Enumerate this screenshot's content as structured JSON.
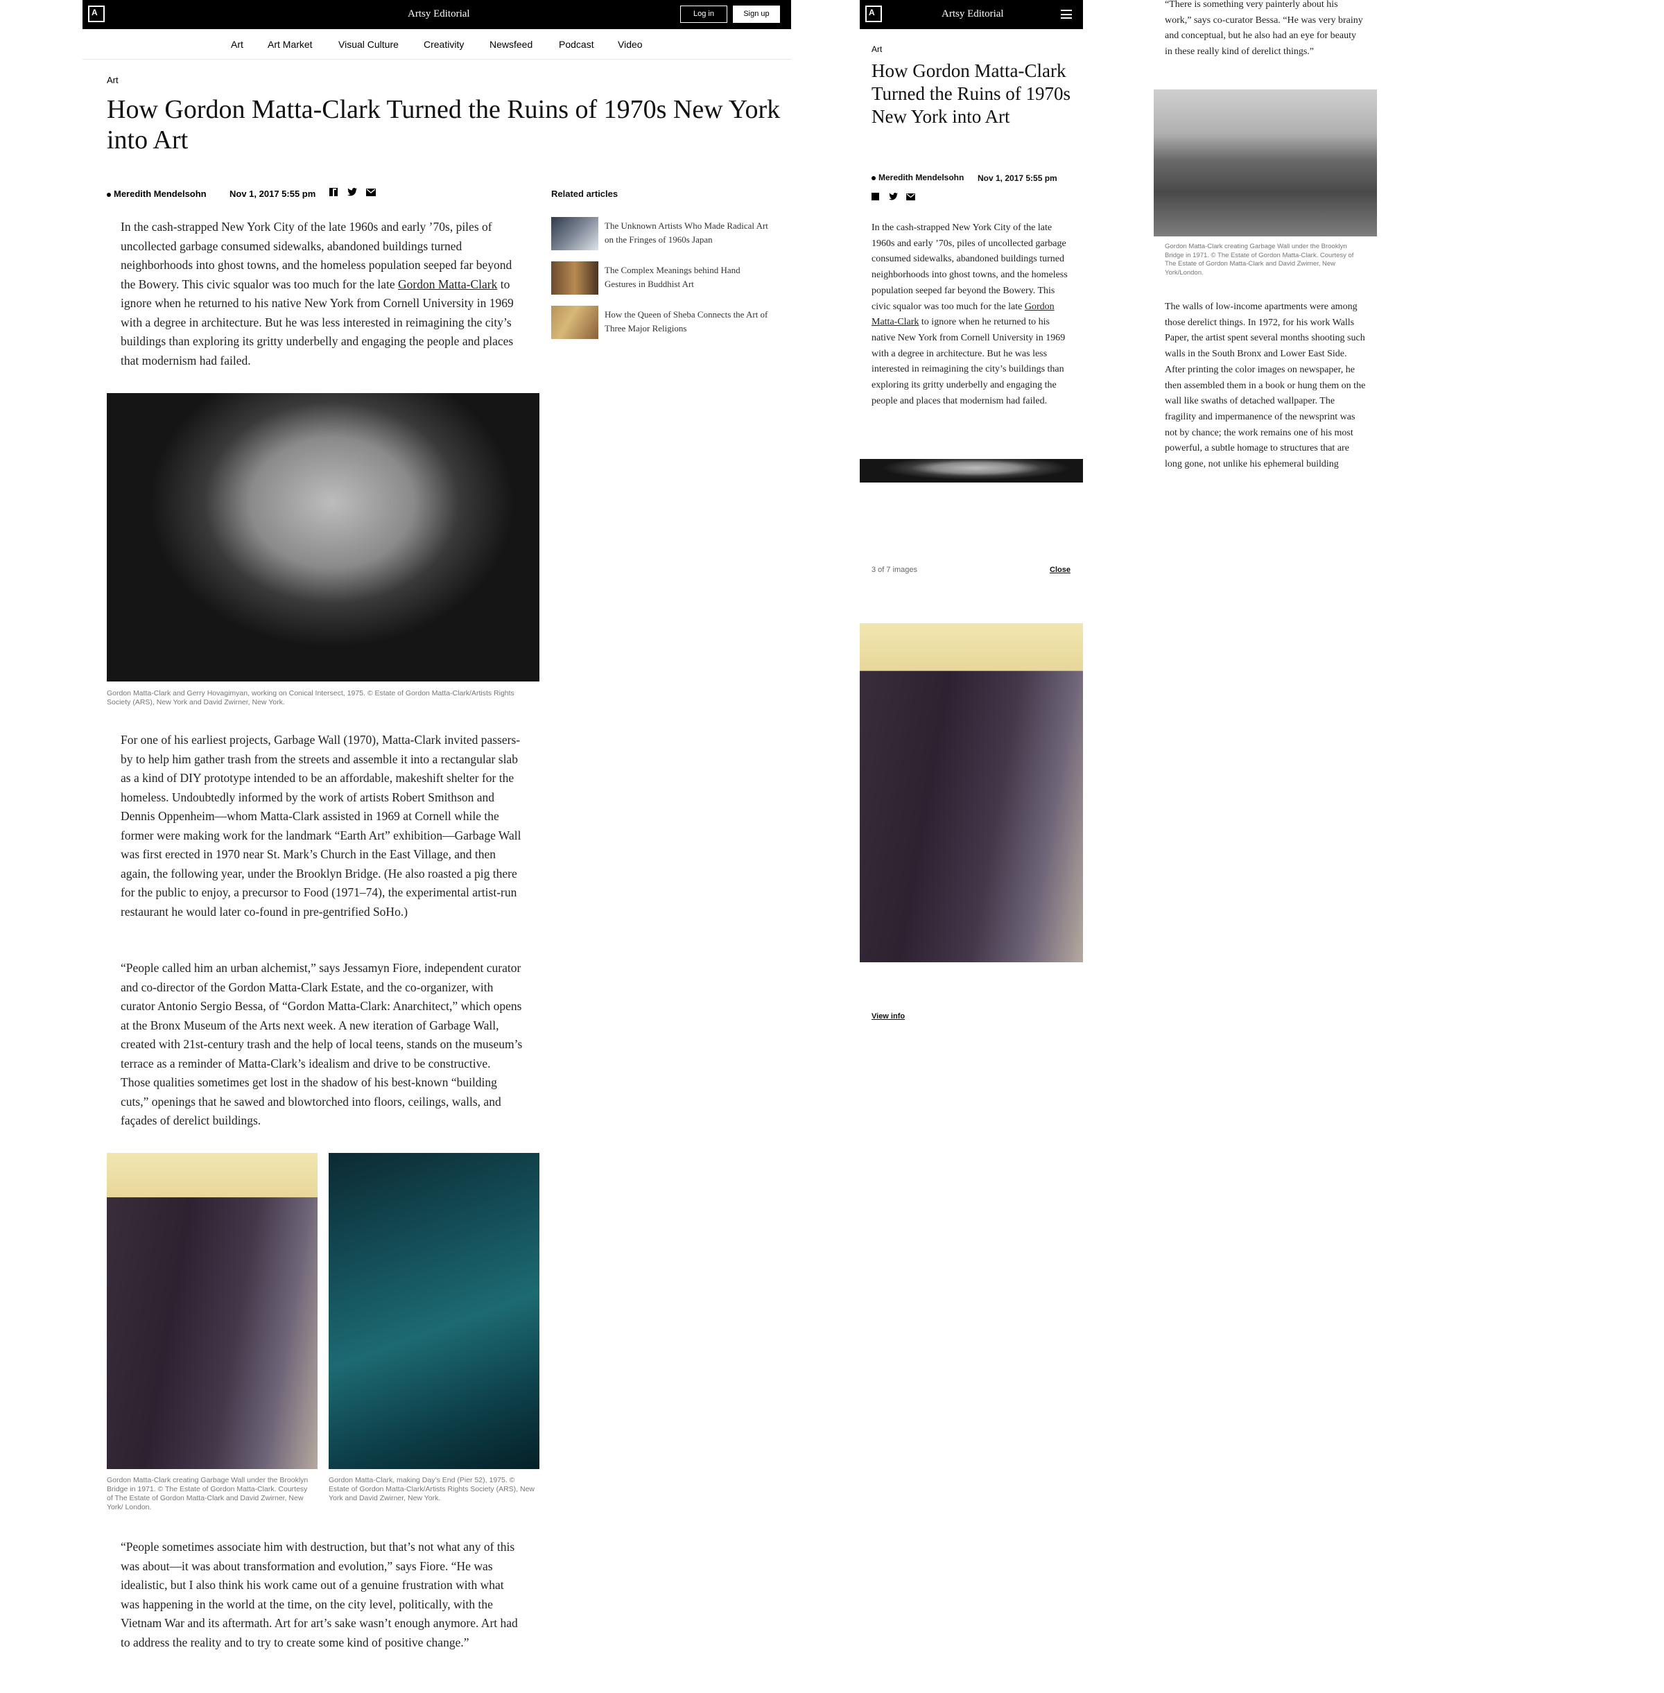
{
  "brand": "Artsy Editorial",
  "logo_text": "A",
  "auth": {
    "login": "Log in",
    "signup": "Sign up"
  },
  "nav": [
    "Art",
    "Art Market",
    "Visual Culture",
    "Creativity",
    "Newsfeed",
    "Podcast",
    "Video"
  ],
  "article": {
    "kicker": "Art",
    "title": "How Gordon Matta-Clark Turned the Ruins of 1970s New York into Art",
    "mobile_title": "How Gordon Matta-Clark Turned the Ruins of 1970s New York into Art",
    "author": "Meredith Mendelsohn",
    "date": "Nov 1, 2017 5:55 pm",
    "share_icons": [
      "facebook-icon",
      "twitter-icon",
      "email-icon"
    ],
    "p1_a": "In the cash-strapped New York City of the late 1960s and early ’70s, piles of uncollected garbage consumed sidewalks, abandoned buildings turned neighborhoods into ghost towns, and the homeless population seeped far beyond the Bowery. This civic squalor was too much for the late ",
    "p1_link": "Gordon Matta-Clark",
    "p1_b": " to ignore when he returned to his native New York from Cornell University in 1969 with a degree in architecture. But he was less interested in reimagining the city’s buildings than exploring its gritty underbelly and engaging the people and places that modernism had failed.",
    "caption1": "Gordon Matta-Clark and Gerry Hovagimyan, working on Conical Intersect, 1975. © Estate of Gordon Matta-Clark/Artists Rights Society (ARS), New York and David Zwirner, New York.",
    "p2": "For one of his earliest projects, Garbage Wall (1970), Matta-Clark invited passers-by to help him gather trash from the streets and assemble it into a rectangular slab as a kind of DIY prototype intended to be an affordable, makeshift shelter for the homeless. Undoubtedly informed by the work of artists Robert Smithson and Dennis Oppenheim—whom Matta-Clark assisted in 1969 at Cornell while the former were making work for the landmark “Earth Art” exhibition—Garbage Wall was first erected in 1970 near St. Mark’s Church in the East Village, and then again, the following year, under the Brooklyn Bridge. (He also roasted a pig there for the public to enjoy, a precursor to Food (1971–74), the experimental artist-run restaurant he would later co-found in pre-gentrified SoHo.)",
    "p3": "“People called him an urban alchemist,” says Jessamyn Fiore, independent curator and co-director of the Gordon Matta-Clark Estate, and the co-organizer, with curator Antonio Sergio Bessa, of “Gordon Matta-Clark: Anarchitect,” which opens at the Bronx Museum of the Arts next week. A new iteration of Garbage Wall, created with 21st-century trash and the help of local teens, stands on the museum’s terrace as a reminder of Matta-Clark’s idealism and drive to be constructive. Those qualities sometimes get lost in the shadow of his best-known “building cuts,” openings that he sawed and blowtorched into floors, ceilings, walls, and façades of derelict buildings.",
    "caption2": "Gordon Matta-Clark creating Garbage Wall  under the Brooklyn Bridge in 1971. © The Estate of Gordon Matta-Clark. Courtesy of The Estate of Gordon Matta-Clark and David Zwirner, New York/ London.",
    "caption3": "Gordon Matta-Clark, making Day’s End (Pier 52), 1975. © Estate of Gordon Matta-Clark/Artists Rights Society (ARS), New York and David Zwirner, New York.",
    "p4": "“People sometimes associate him with destruction, but that’s not what any of this was about—it was about transformation and evolution,” says Fiore. “He was idealistic, but I also think his work came out of a genuine frustration with what was happening in the world at the time, on the city level, politically, with the Vietnam War and its aftermath. Art for art’s sake wasn’t enough anymore. Art had to address the reality and to try to create some kind of positive change.”"
  },
  "related": {
    "title": "Related articles",
    "items": [
      "The Unknown Artists Who Made Radical Art on the Fringes of 1960s Japan",
      "The Complex Meanings behind Hand Gestures in Buddhist Art",
      "How the Queen of Sheba Connects the Art of Three Major Religions"
    ]
  },
  "mobile": {
    "gallery_count": "3 of 7 images",
    "close": "Close",
    "view_info": "View info",
    "quote_top": "“There is something very painterly about his work,” says co-curator Bessa. “He was very brainy and conceptual, but he also had an eye for beauty in these really kind of derelict things.”",
    "caption_bw": "Gordon Matta-Clark creating Garbage Wall  under the Brooklyn Bridge in 1971. © The Estate of Gordon Matta-Clark. Courtesy of The Estate of Gordon Matta-Clark and David Zwirner, New York/London.",
    "p_walls": "The walls of low-income apartments were among those derelict things. In 1972, for his work Walls Paper, the artist spent several months shooting such walls in the South Bronx and Lower East Side. After printing the color images on newspaper, he then assembled them in a book or hung them on the wall like swaths of detached wallpaper. The fragility and impermanence of the newsprint was not by chance; the work remains one of his most powerful, a subtle homage to structures that are long gone, not unlike his ephemeral building"
  }
}
